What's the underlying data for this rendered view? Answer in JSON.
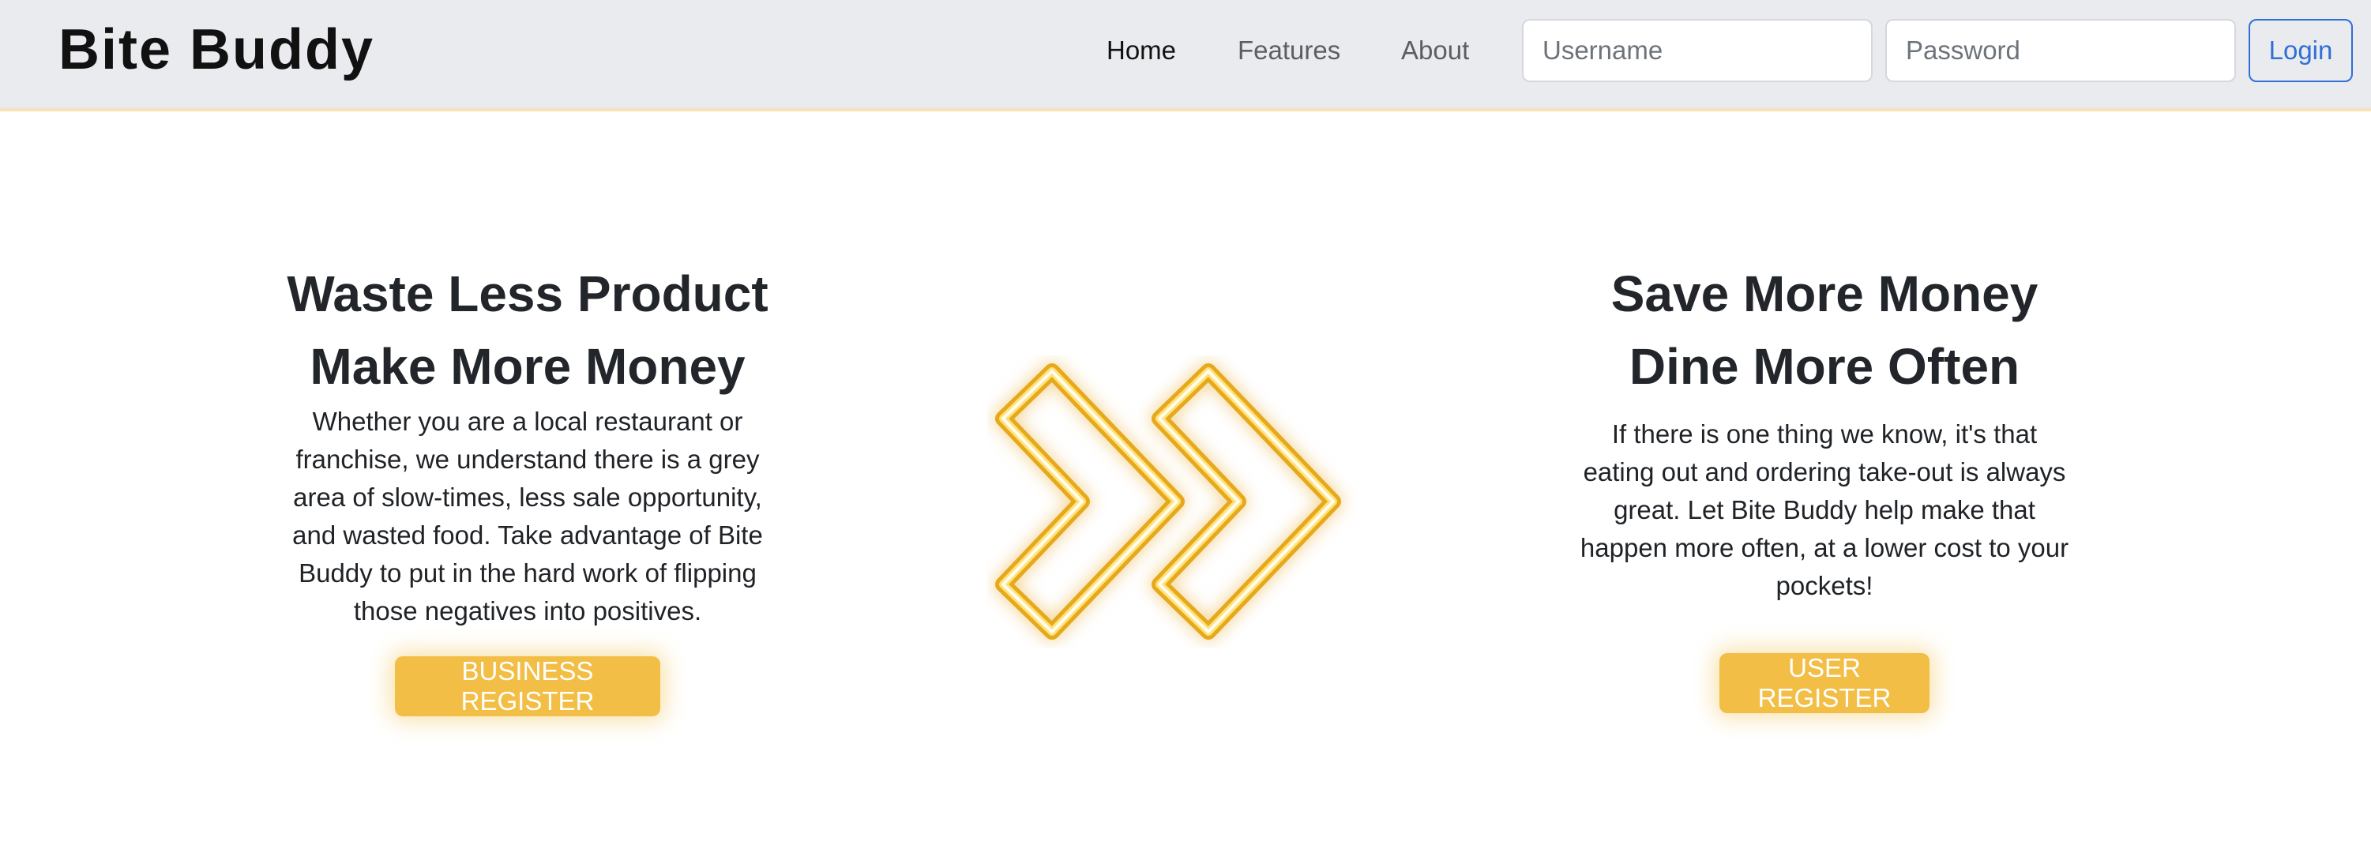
{
  "navbar": {
    "brand": "Bite Buddy",
    "links": [
      "Home",
      "Features",
      "About"
    ],
    "username_placeholder": "Username",
    "password_placeholder": "Password",
    "login_label": "Login"
  },
  "hero": {
    "left": {
      "heading_line1": "Waste Less Product",
      "heading_line2": "Make More Money",
      "body": "Whether you are a local restaurant or franchise, we understand there is a grey area of slow-times, less sale opportunity, and wasted food. Take advantage of Bite Buddy to put in the hard work of flipping those negatives into positives.",
      "button_label": "BUSINESS REGISTER"
    },
    "right": {
      "heading_line1": "Save More Money",
      "heading_line2": "Dine More Often",
      "body": "If there is one thing we know, it's that eating out and ordering take-out is always great. Let Bite Buddy help make that happen more often, at a lower cost to your pockets!",
      "button_label": "USER REGISTER"
    },
    "center_icon": "double-chevron-right-neon-icon"
  },
  "colors": {
    "navbar_bg": "#e9ebef",
    "accent": "#f2be45",
    "login_blue": "#2f6fd6",
    "heading": "#22252a"
  }
}
